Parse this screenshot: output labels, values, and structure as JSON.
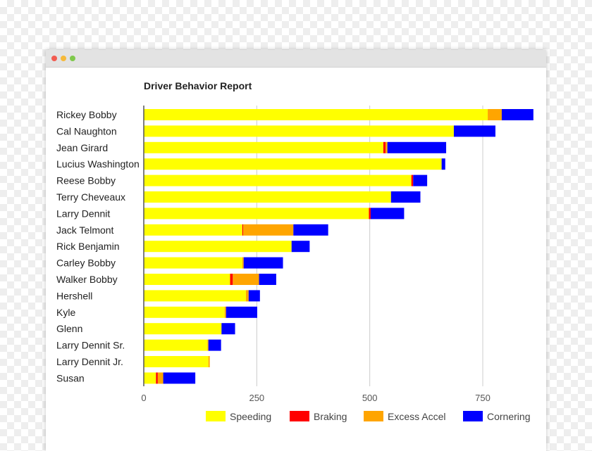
{
  "window": {
    "controls": [
      "close",
      "minimize",
      "maximize"
    ]
  },
  "chart_data": {
    "type": "bar",
    "orientation": "horizontal",
    "stacked": true,
    "title": "Driver Behavior Report",
    "categories": [
      "Rickey Bobby",
      "Cal Naughton",
      "Jean Girard",
      "Lucius Washington",
      "Reese Bobby",
      "Terry Cheveaux",
      "Larry Dennit",
      "Jack Telmont",
      "Rick Benjamin",
      "Carley Bobby",
      "Walker Bobby",
      "Hershell",
      "Kyle",
      "Glenn",
      "Larry Dennit Sr.",
      "Larry Dennit Jr.",
      "Susan"
    ],
    "series": [
      {
        "name": "Speeding",
        "color": "#ffff00",
        "values": [
          761,
          686,
          530,
          659,
          592,
          547,
          498,
          218,
          327,
          218,
          191,
          226,
          179,
          172,
          141,
          143,
          27
        ]
      },
      {
        "name": "Braking",
        "color": "#ff0000",
        "values": [
          0,
          0,
          5,
          0,
          4,
          0,
          4,
          2,
          0,
          0,
          6,
          0,
          0,
          0,
          0,
          0,
          4
        ]
      },
      {
        "name": "Excess Accel",
        "color": "#ffa500",
        "values": [
          31,
          0,
          4,
          0,
          0,
          0,
          0,
          111,
          0,
          3,
          58,
          6,
          3,
          0,
          2,
          3,
          12
        ]
      },
      {
        "name": "Cornering",
        "color": "#0000ff",
        "values": [
          70,
          92,
          130,
          8,
          31,
          65,
          74,
          77,
          40,
          87,
          38,
          25,
          69,
          30,
          28,
          0,
          71
        ]
      }
    ],
    "xlim": [
      0,
      860
    ],
    "xticks": [
      "0",
      "250",
      "500",
      "750"
    ],
    "grid": true,
    "legend": "bottom"
  }
}
